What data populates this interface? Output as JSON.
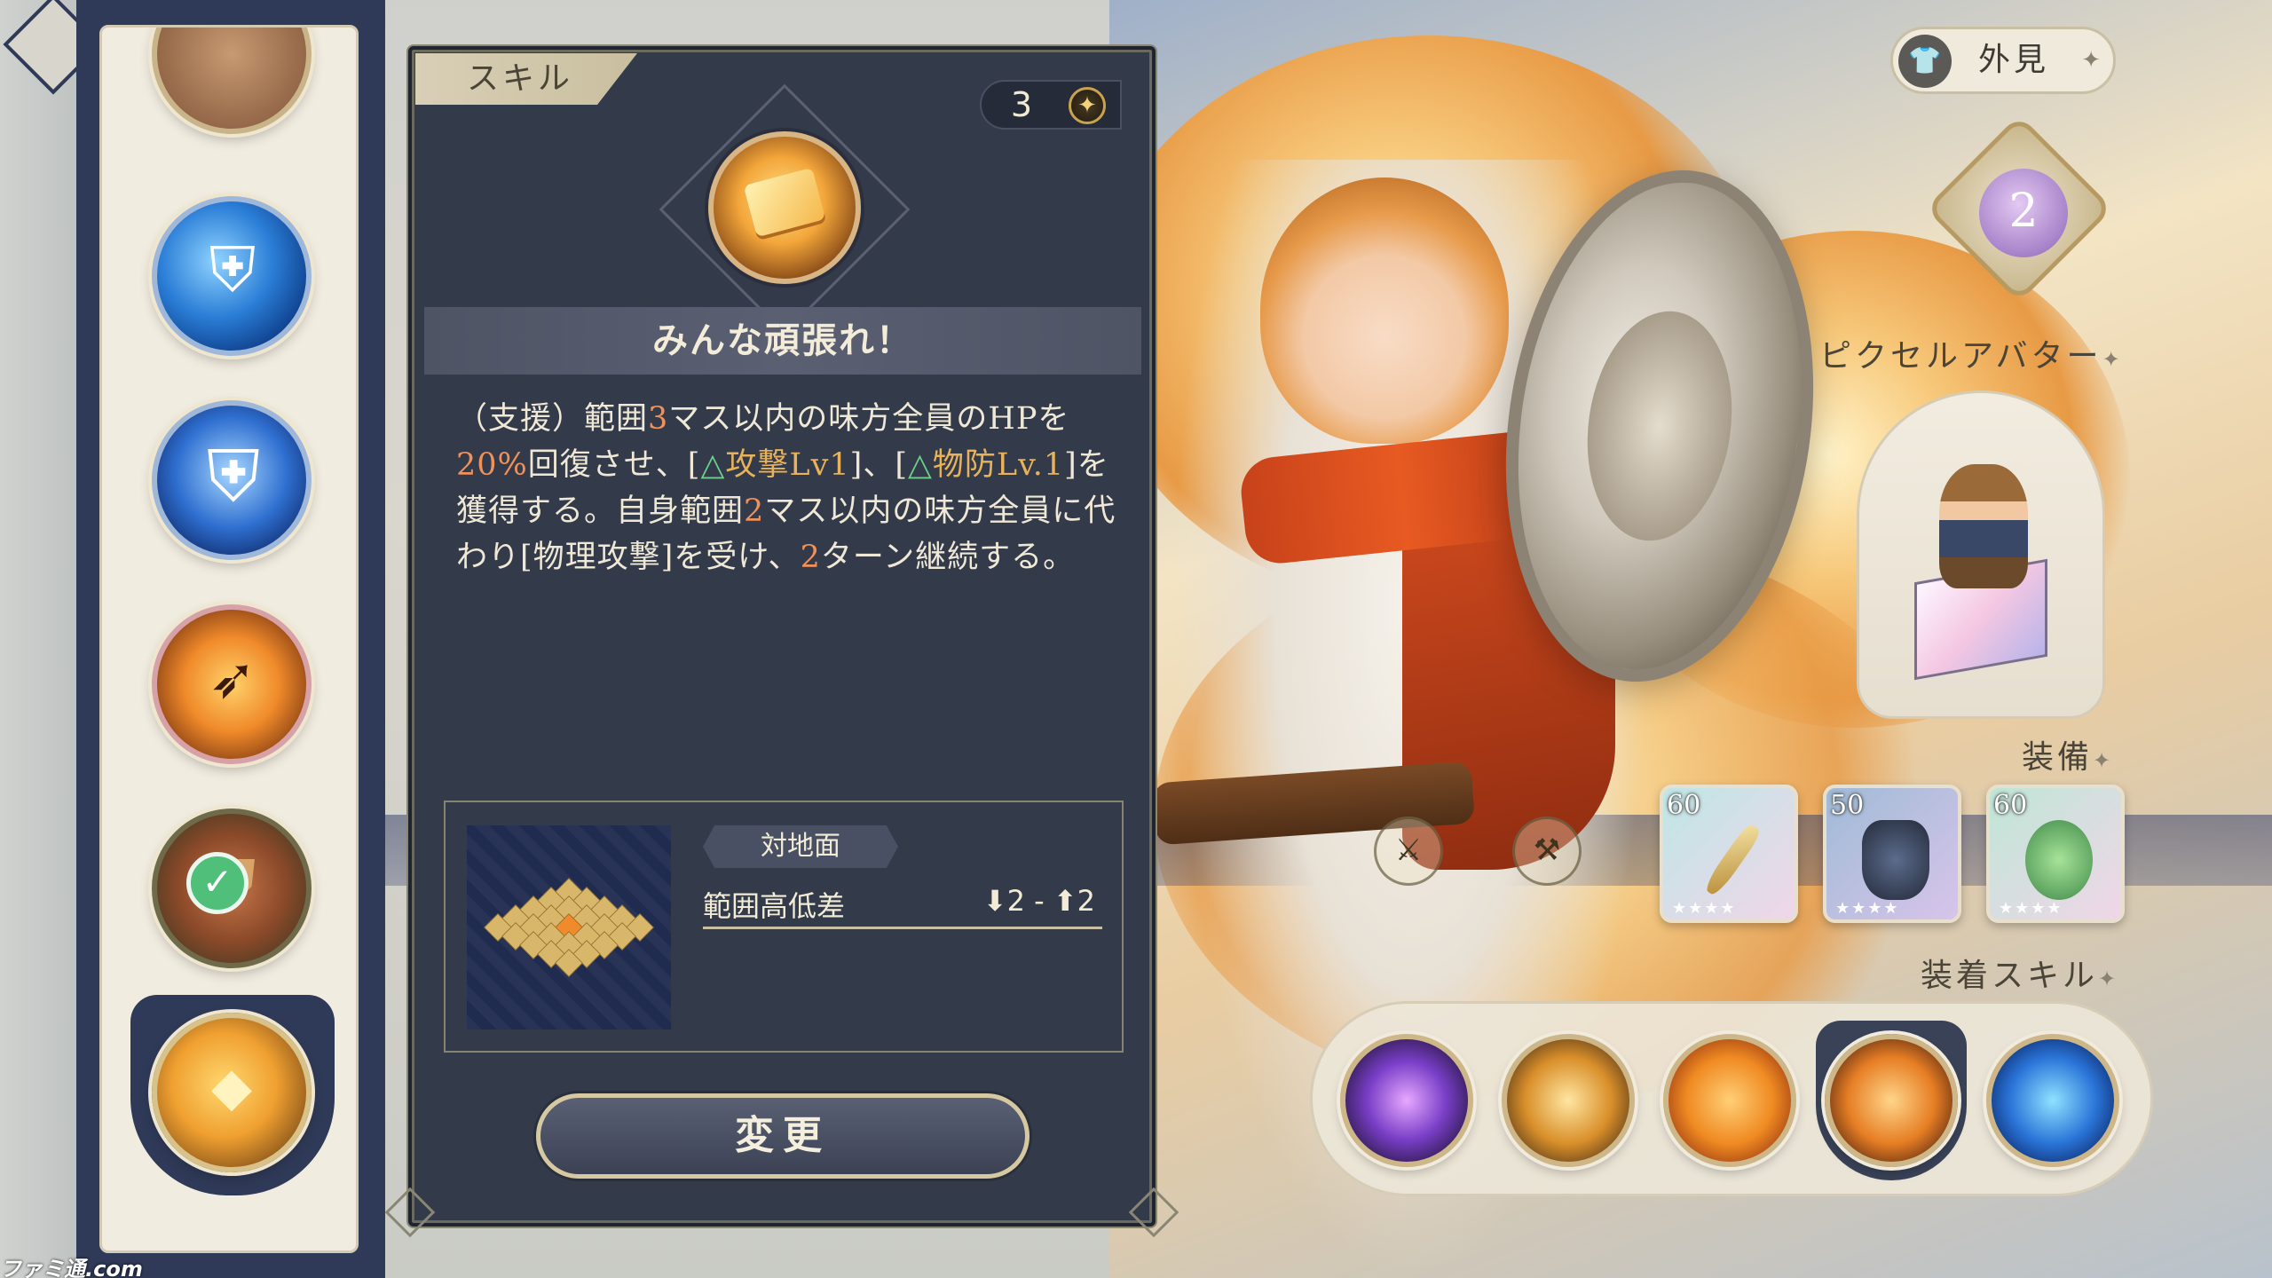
{
  "rail": {
    "title": "スキル"
  },
  "panel": {
    "tab_label": "スキル",
    "cost": "3",
    "skill_name": "みんな頑張れ！",
    "description": {
      "p1": "（支援）範囲",
      "n1": "3",
      "p2": "マス以内の味方全員のHPを",
      "n2": "20%",
      "p3": "回復させ、[",
      "b1": "攻撃Lv1",
      "p4": "]、[",
      "b2": "物防Lv.1",
      "p5": "]を獲得する。自身範囲",
      "n3": "2",
      "p6": "マス以内の味方全員に代わり[物理攻撃]を受け、",
      "n4": "2",
      "p7": "ターン継続する。"
    },
    "range": {
      "ground_label": "対地面",
      "height_label": "範囲高低差",
      "height_value": "⬇2 - ⬆2"
    },
    "change_button": "変更"
  },
  "right": {
    "appearance_label": "外見",
    "rank_value": "2",
    "pixel_avatar_label": "ピクセルアバター",
    "equipment_label": "装備",
    "equipment": [
      {
        "level": "60"
      },
      {
        "level": "50"
      },
      {
        "level": "60"
      }
    ],
    "equipped_skills_label": "装着スキル"
  },
  "watermark": "ファミ通.com",
  "colors": {
    "panel_bg": "#333a4a",
    "rail_bg": "#f1ece0",
    "rail_frame": "#2f3a58",
    "highlight_number": "#f0915a",
    "buff_text": "#e8b25a",
    "buff_triangle": "#6cd08a"
  }
}
